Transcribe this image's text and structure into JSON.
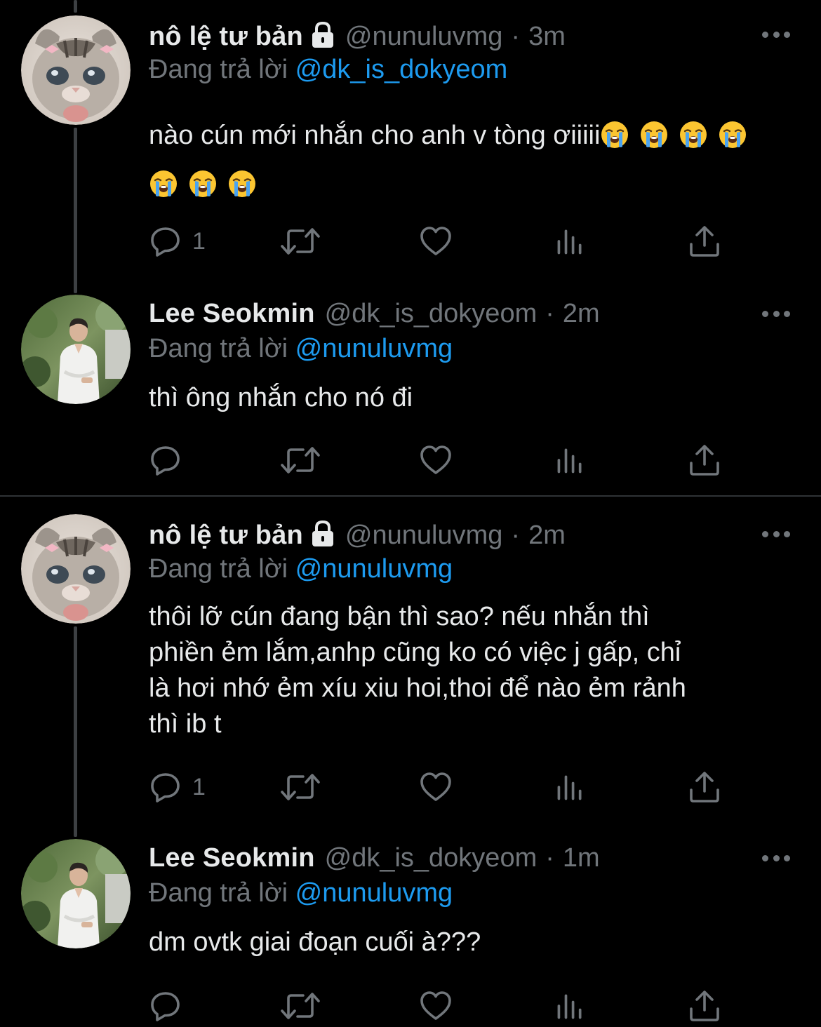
{
  "colors": {
    "background": "#000000",
    "primary_text": "#e7e9ea",
    "secondary_text": "#71767b",
    "accent": "#1d9bf0",
    "divider": "#2f3336"
  },
  "tweets": [
    {
      "display_name": "nô lệ tư bản",
      "locked": true,
      "handle": "@nunuluvmg",
      "time": "3m",
      "reply_prefix": "Đang trả lời",
      "reply_to": "@dk_is_dokyeom",
      "text": "nào cún mới nhắn cho anh v tòng ơiiiii",
      "emoji": "loudly-crying-face",
      "emoji_count": 7,
      "reply_count": "1",
      "avatar": "cat-avatar"
    },
    {
      "display_name": "Lee Seokmin",
      "locked": false,
      "handle": "@dk_is_dokyeom",
      "time": "2m",
      "reply_prefix": "Đang trả lời",
      "reply_to": "@nunuluvmg",
      "text": "thì ông nhắn cho nó đi",
      "reply_count": "",
      "avatar": "man-avatar"
    },
    {
      "display_name": "nô lệ tư bản",
      "locked": true,
      "handle": "@nunuluvmg",
      "time": "2m",
      "reply_prefix": "Đang trả lời",
      "reply_to": "@nunuluvmg",
      "text_lines": [
        "thôi lỡ cún đang bận thì sao? nếu nhắn thì",
        "phiền ẻm lắm,anhp cũng ko có việc j gấp, chỉ",
        "là hơi nhớ ẻm xíu xiu hoi,thoi để nào ẻm rảnh",
        "thì ib t"
      ],
      "reply_count": "1",
      "avatar": "cat-avatar"
    },
    {
      "display_name": "Lee Seokmin",
      "locked": false,
      "handle": "@dk_is_dokyeom",
      "time": "1m",
      "reply_prefix": "Đang trả lời",
      "reply_to": "@nunuluvmg",
      "text": "dm ovtk giai đoạn cuối à???",
      "reply_count": "",
      "avatar": "man-avatar"
    }
  ],
  "icons": {
    "reply": "reply-icon",
    "retweet": "retweet-icon",
    "like": "heart-icon",
    "views": "views-icon",
    "share": "share-icon",
    "more": "more-icon",
    "lock": "lock-icon"
  }
}
